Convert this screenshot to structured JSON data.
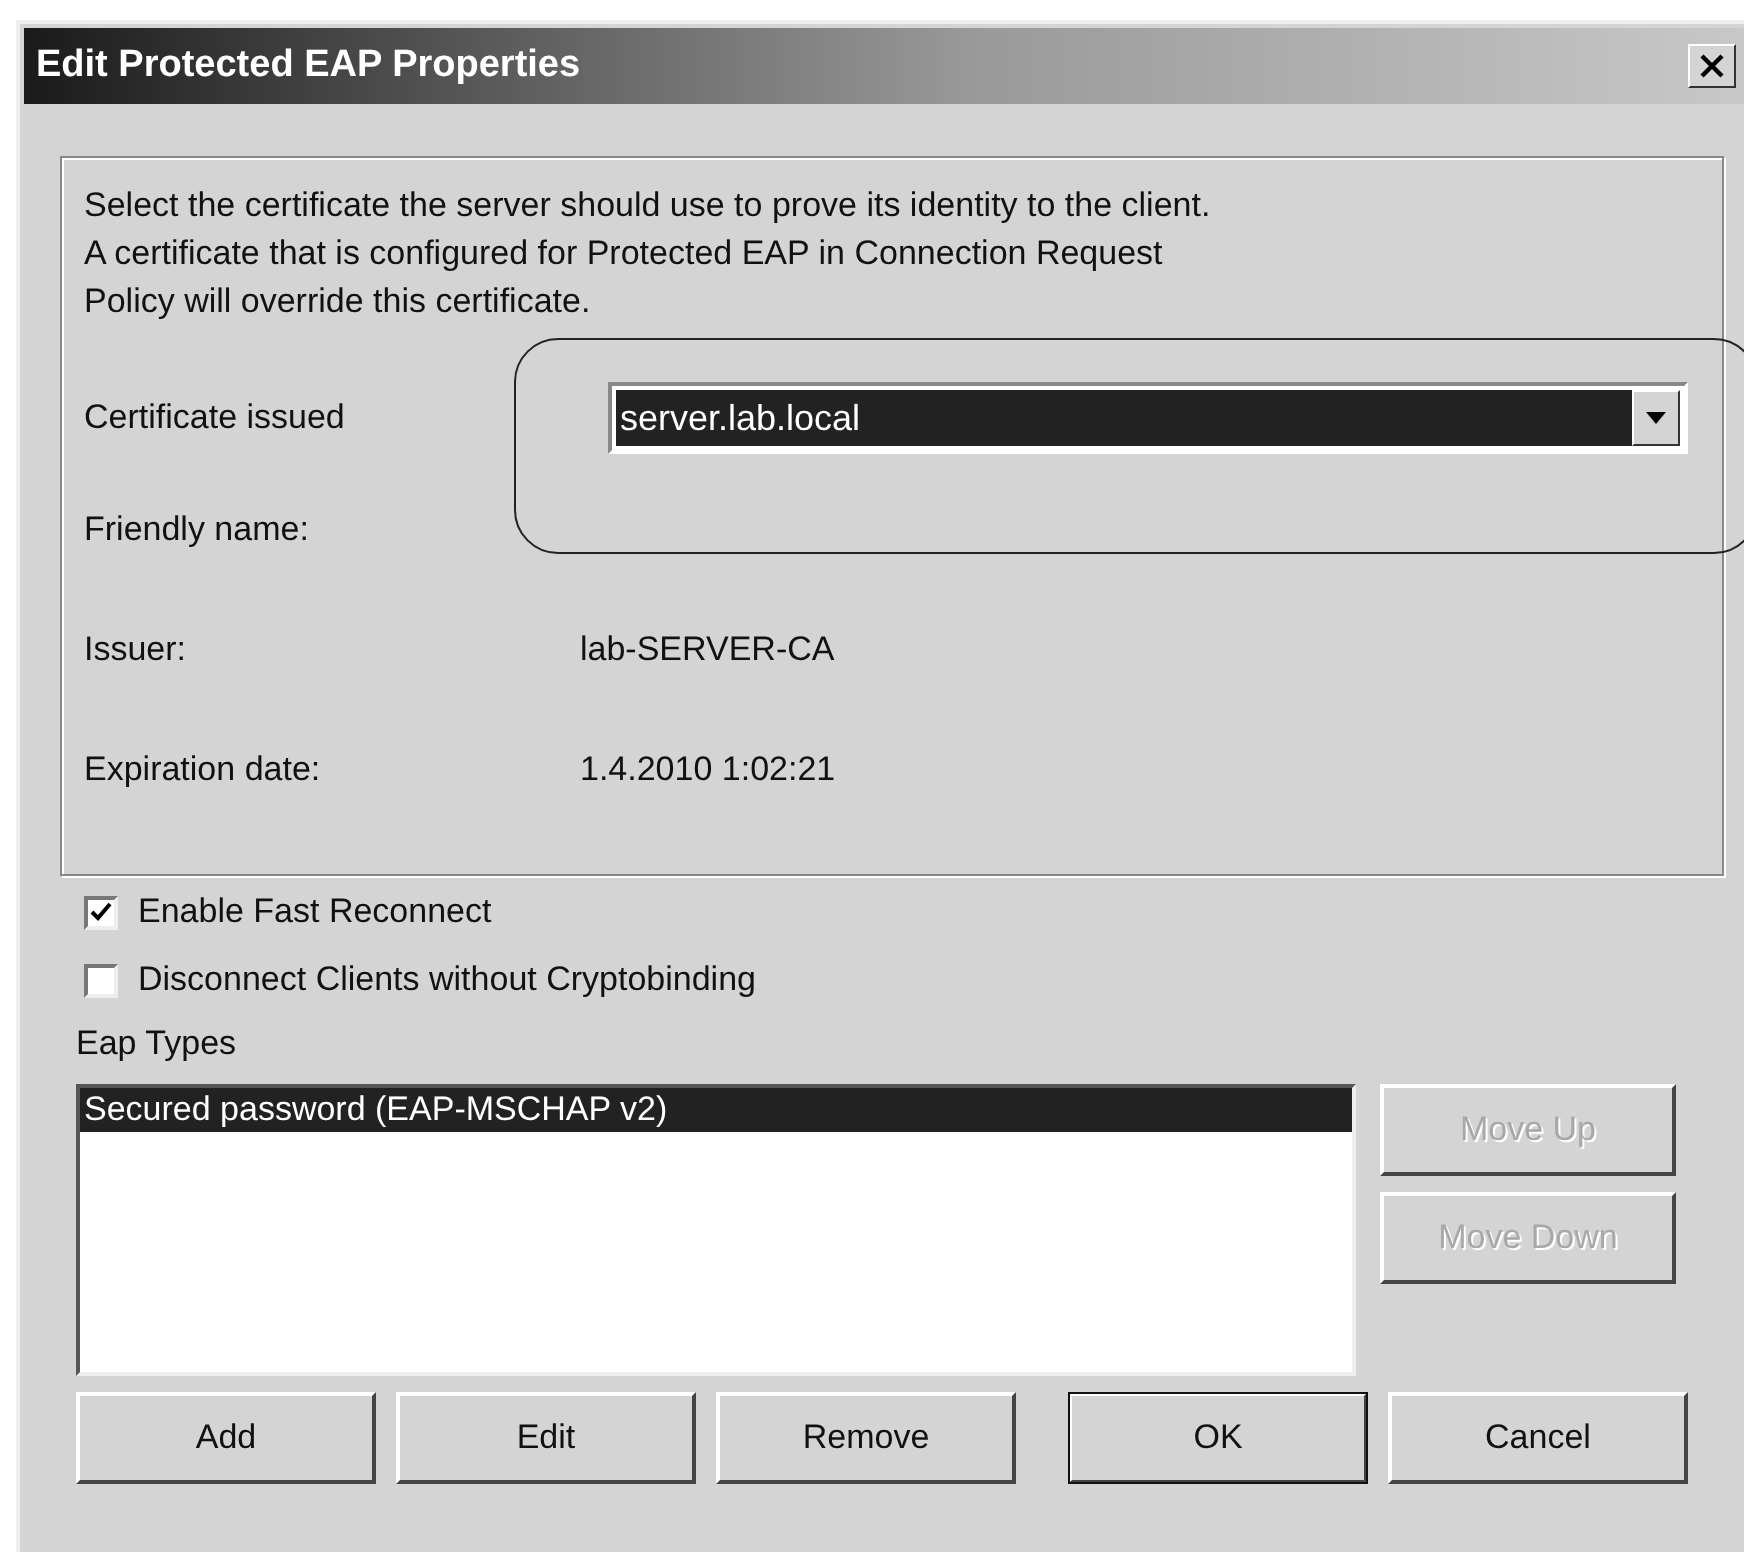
{
  "window": {
    "title": "Edit Protected EAP Properties"
  },
  "intro": "Select the certificate the server should use to prove its identity to the client.\nA certificate that is configured for Protected EAP in Connection Request\nPolicy will override this certificate.",
  "fields": [
    {
      "label": "Certificate issued",
      "kind": "dropdown",
      "value": "server.lab.local"
    },
    {
      "label": "Friendly name:",
      "kind": "text"
    },
    {
      "label": "Issuer:",
      "kind": "text",
      "value": "lab-SERVER-CA"
    },
    {
      "label": "Expiration date:",
      "kind": "text",
      "value": "1.4.2010 1:02:21"
    }
  ],
  "checkboxes": [
    {
      "label": "Enable Fast Reconnect",
      "checked": true
    },
    {
      "label": "Disconnect Clients without Cryptobinding",
      "checked": false
    }
  ],
  "eap_types": {
    "label": "Eap Types",
    "items": [
      {
        "text": "Secured password (EAP-MSCHAP v2)",
        "selected": true
      }
    ]
  },
  "side_buttons": [
    {
      "label": "Move Up",
      "disabled": true
    },
    {
      "label": "Move Down",
      "disabled": true
    }
  ],
  "buttons": [
    {
      "label": "Add",
      "default": false
    },
    {
      "label": "Edit",
      "default": false
    },
    {
      "label": "Remove",
      "default": false
    },
    {
      "label": "OK",
      "default": true
    },
    {
      "label": "Cancel",
      "default": false
    }
  ]
}
